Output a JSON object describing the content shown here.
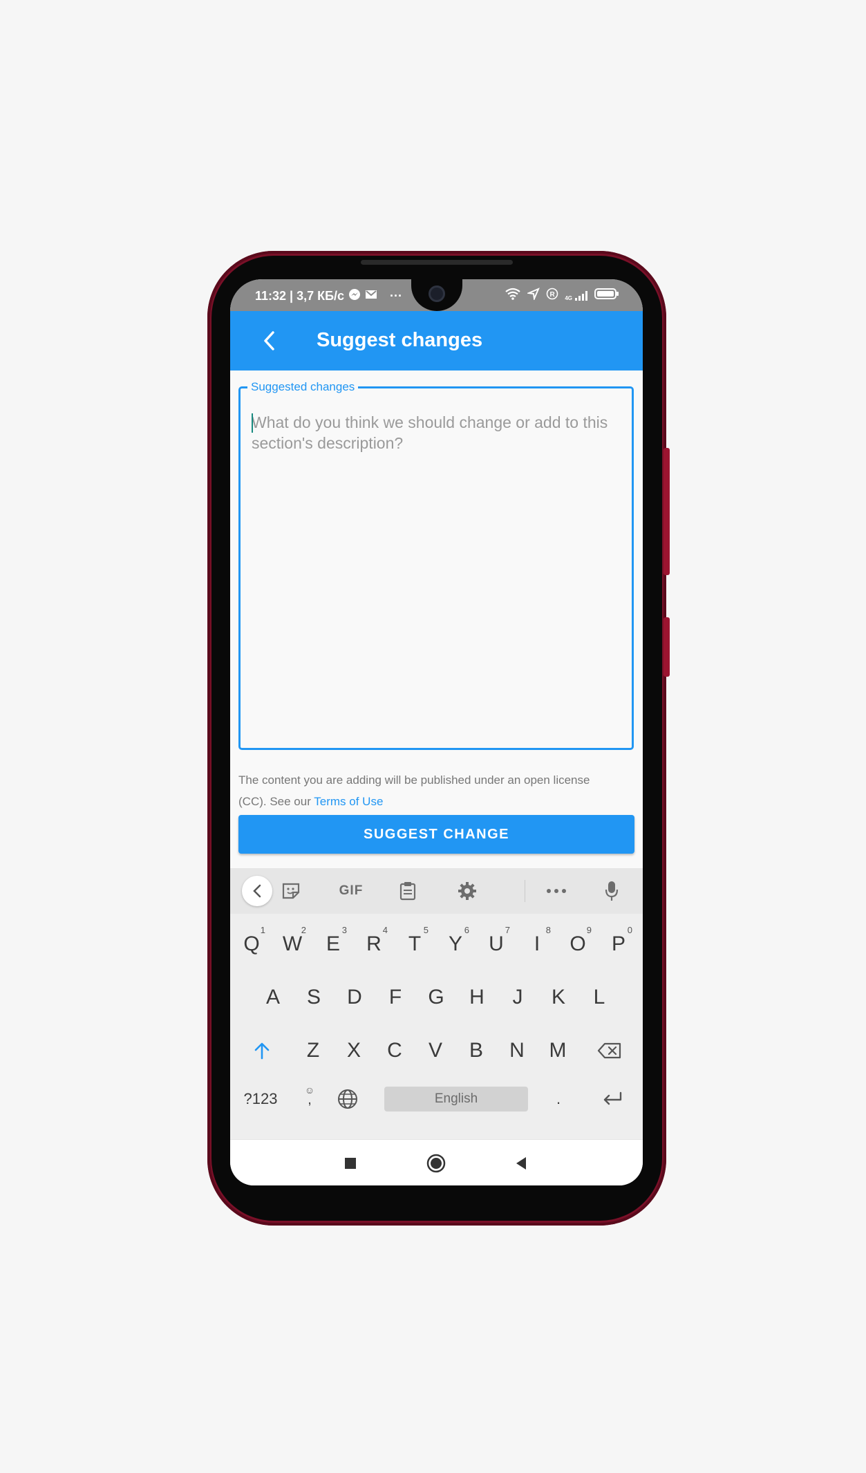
{
  "status_bar": {
    "time_speed": "11:32 | 3,7 КБ/с",
    "icons": [
      "messenger-icon",
      "gmail-icon",
      "more-dots-icon",
      "wifi-icon",
      "location-icon",
      "r-icon",
      "4g-signal-icon",
      "battery-icon"
    ],
    "more": "···",
    "net": "4G"
  },
  "appbar": {
    "title": "Suggest changes",
    "back_icon": "back-arrow-icon",
    "color": "#2196f3"
  },
  "field": {
    "label": "Suggested changes",
    "placeholder": "What do you think we should change or add to this section's description?",
    "value": ""
  },
  "license": {
    "text": "The content you are adding will be published under an open license (CC). See our ",
    "link": "Terms of Use"
  },
  "submit": {
    "label": "SUGGEST CHANGE"
  },
  "keyboard": {
    "toolbar": {
      "gif": "GIF"
    },
    "row1": [
      {
        "k": "Q",
        "n": "1"
      },
      {
        "k": "W",
        "n": "2"
      },
      {
        "k": "E",
        "n": "3"
      },
      {
        "k": "R",
        "n": "4"
      },
      {
        "k": "T",
        "n": "5"
      },
      {
        "k": "Y",
        "n": "6"
      },
      {
        "k": "U",
        "n": "7"
      },
      {
        "k": "I",
        "n": "8"
      },
      {
        "k": "O",
        "n": "9"
      },
      {
        "k": "P",
        "n": "0"
      }
    ],
    "row2": [
      "A",
      "S",
      "D",
      "F",
      "G",
      "H",
      "J",
      "K",
      "L"
    ],
    "row3": [
      "Z",
      "X",
      "C",
      "V",
      "B",
      "N",
      "M"
    ],
    "symbols": "?123",
    "comma": ",",
    "space": "English",
    "period": "."
  }
}
